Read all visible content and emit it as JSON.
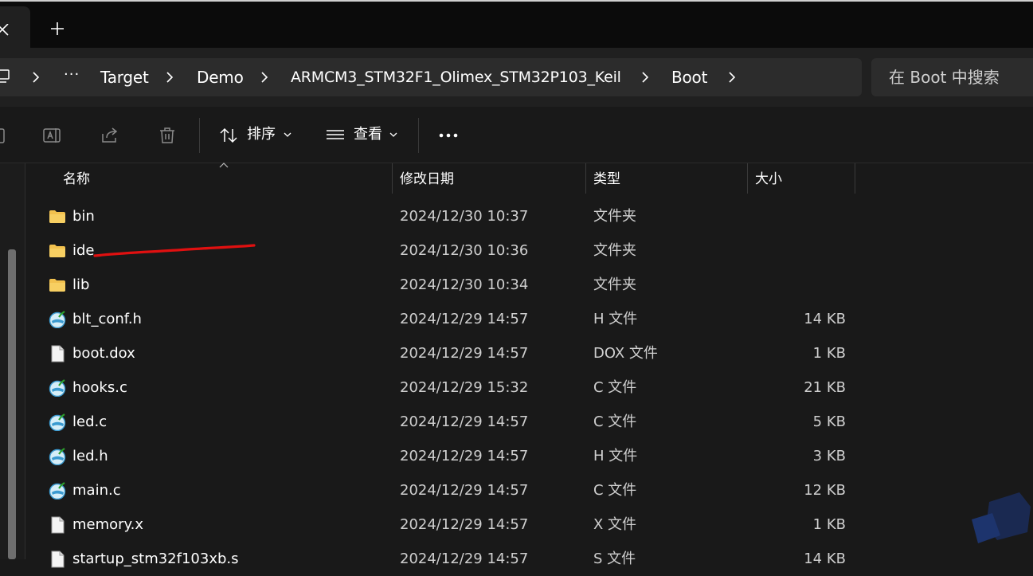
{
  "tabbar": {
    "close_icon": "close-icon",
    "new_tab_icon": "plus-icon"
  },
  "navbar": {
    "breadcrumbs": [
      "Target",
      "Demo",
      "ARMCM3_STM32F1_Olimex_STM32P103_Keil",
      "Boot"
    ],
    "overflow": "···",
    "search_placeholder": "在 Boot 中搜索"
  },
  "toolbar": {
    "sort_label": "排序",
    "view_label": "查看",
    "more_label": "···"
  },
  "columns": {
    "name": "名称",
    "date": "修改日期",
    "type": "类型",
    "size": "大小"
  },
  "files": [
    {
      "name": "bin",
      "date": "2024/12/30 10:37",
      "type": "文件夹",
      "size": "",
      "icon": "folder-icon"
    },
    {
      "name": "ide",
      "date": "2024/12/30 10:36",
      "type": "文件夹",
      "size": "",
      "icon": "folder-icon"
    },
    {
      "name": "lib",
      "date": "2024/12/30 10:34",
      "type": "文件夹",
      "size": "",
      "icon": "folder-icon"
    },
    {
      "name": "blt_conf.h",
      "date": "2024/12/29 14:57",
      "type": "H 文件",
      "size": "14 KB",
      "icon": "source-file-icon"
    },
    {
      "name": "boot.dox",
      "date": "2024/12/29 14:57",
      "type": "DOX 文件",
      "size": "1 KB",
      "icon": "blank-file-icon"
    },
    {
      "name": "hooks.c",
      "date": "2024/12/29 15:32",
      "type": "C 文件",
      "size": "21 KB",
      "icon": "source-file-icon"
    },
    {
      "name": "led.c",
      "date": "2024/12/29 14:57",
      "type": "C 文件",
      "size": "5 KB",
      "icon": "source-file-icon"
    },
    {
      "name": "led.h",
      "date": "2024/12/29 14:57",
      "type": "H 文件",
      "size": "3 KB",
      "icon": "source-file-icon"
    },
    {
      "name": "main.c",
      "date": "2024/12/29 14:57",
      "type": "C 文件",
      "size": "12 KB",
      "icon": "source-file-icon"
    },
    {
      "name": "memory.x",
      "date": "2024/12/29 14:57",
      "type": "X 文件",
      "size": "1 KB",
      "icon": "blank-file-icon"
    },
    {
      "name": "startup_stm32f103xb.s",
      "date": "2024/12/29 14:57",
      "type": "S 文件",
      "size": "14 KB",
      "icon": "blank-file-icon"
    }
  ],
  "colors": {
    "background": "#191919",
    "folder": "#f2c14e",
    "annotation": "#e01010"
  }
}
